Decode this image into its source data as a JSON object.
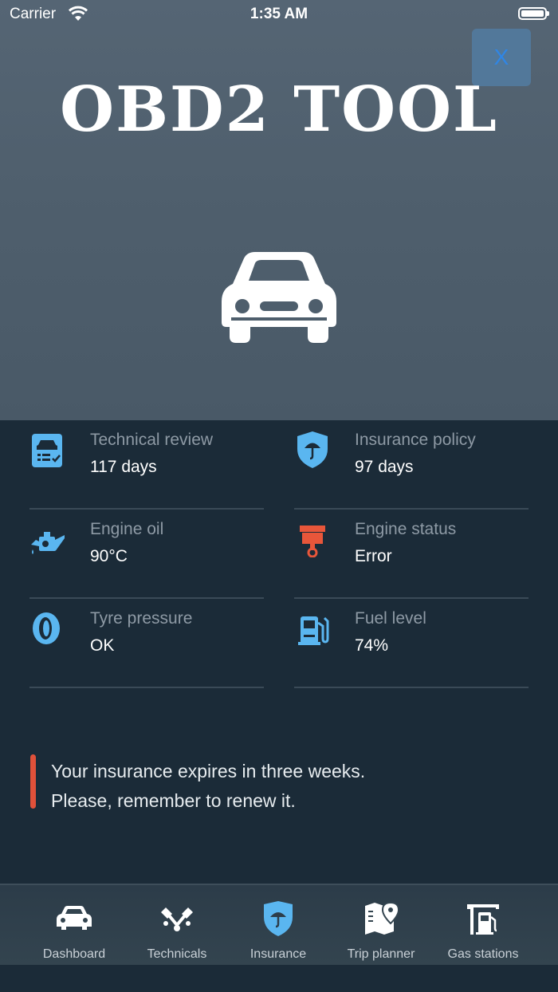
{
  "status_bar": {
    "carrier": "Carrier",
    "time": "1:35 AM"
  },
  "header": {
    "title": "OBD2 TOOL",
    "close_label": "X"
  },
  "stats": [
    {
      "label": "Technical review",
      "value": "117 days",
      "icon": "clipboard-car-icon"
    },
    {
      "label": "Insurance policy",
      "value": "97 days",
      "icon": "shield-umbrella-icon"
    },
    {
      "label": "Engine oil",
      "value": "90°C",
      "icon": "oil-can-icon"
    },
    {
      "label": "Engine status",
      "value": "Error",
      "icon": "piston-icon"
    },
    {
      "label": "Tyre pressure",
      "value": "OK",
      "icon": "tyre-icon"
    },
    {
      "label": "Fuel level",
      "value": "74%",
      "icon": "fuel-pump-icon"
    }
  ],
  "alert": {
    "line1": "Your insurance expires in three weeks.",
    "line2": "Please, remember to renew it."
  },
  "tabs": [
    {
      "label": "Dashboard",
      "icon": "car-icon"
    },
    {
      "label": "Technicals",
      "icon": "tools-icon"
    },
    {
      "label": "Insurance",
      "icon": "shield-umbrella-icon"
    },
    {
      "label": "Trip planner",
      "icon": "map-pin-icon"
    },
    {
      "label": "Gas stations",
      "icon": "fuel-pump-icon"
    }
  ],
  "colors": {
    "accent": "#4ab3f4",
    "alert": "#e0513a",
    "error_icon": "#e8563a"
  }
}
